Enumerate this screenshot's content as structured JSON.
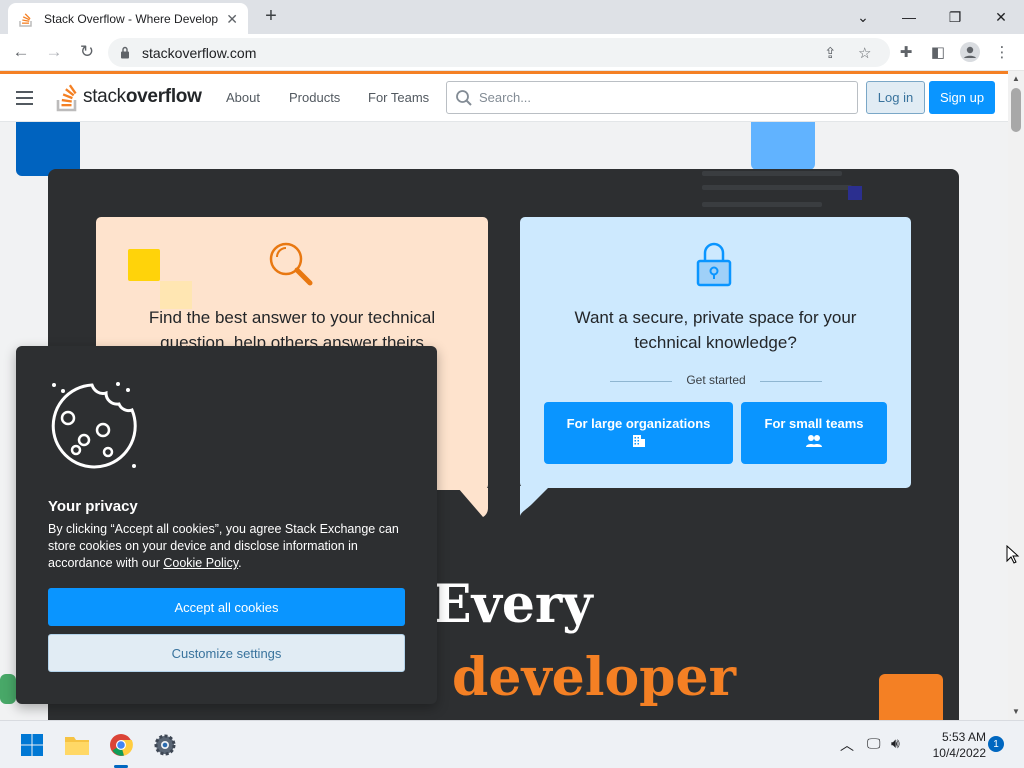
{
  "browser": {
    "tab_title": "Stack Overflow - Where Develop",
    "url": "stackoverflow.com",
    "window_controls": [
      "minimize-icon",
      "restore-icon",
      "close-icon"
    ]
  },
  "header": {
    "logo_text_light": "stack",
    "logo_text_bold": "overflow",
    "nav": [
      "About",
      "Products",
      "For Teams"
    ],
    "search_placeholder": "Search...",
    "login_label": "Log in",
    "signup_label": "Sign up"
  },
  "cards": {
    "left_text": "Find the best answer to your technical question, help others answer theirs",
    "right_text": "Want a secure, private space for your technical knowledge?",
    "get_started": "Get started",
    "large_orgs_label": "For large organizations",
    "small_teams_label": "For small teams"
  },
  "hero": {
    "line1": "Every",
    "line2": "developer"
  },
  "cookie": {
    "title": "Your privacy",
    "body_prefix": "By clicking “Accept all cookies”, you agree Stack Exchange can store cookies on your device and disclose information in accordance with our ",
    "policy_link": "Cookie Policy",
    "body_suffix": ".",
    "accept_label": "Accept all cookies",
    "customize_label": "Customize settings"
  },
  "taskbar": {
    "time": "5:53 AM",
    "date": "10/4/2022",
    "notification_count": "1"
  },
  "colors": {
    "brand_orange": "#f48024",
    "primary_blue": "#0a95ff",
    "dark_panel": "#2d2f31",
    "card_orange": "#fee3cd",
    "card_blue": "#cde9fe"
  }
}
